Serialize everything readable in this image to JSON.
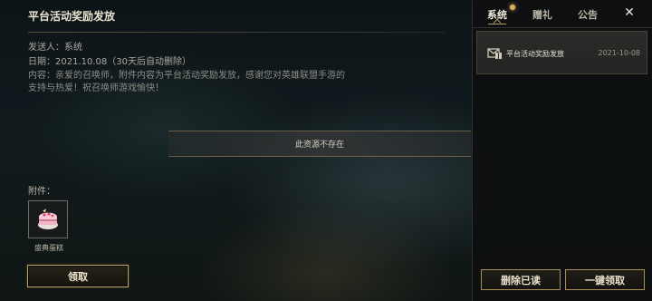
{
  "mail_detail": {
    "title": "平台活动奖励发放",
    "sender_label": "发送人：",
    "sender_value": "系统",
    "date_label": "日期：",
    "date_value": "2021.10.08（30天后自动删除）",
    "content_label": "内容：",
    "content_line1": "亲爱的召唤师，附件内容为平台活动奖励发放，感谢您对英雄联盟手游的",
    "content_line2": "支持与热爱！祝召唤师游戏愉快！",
    "attachments_label": "附件：",
    "attachments": [
      {
        "name": "盛典蛋糕",
        "icon": "cake-icon"
      }
    ],
    "claim_button": "领取"
  },
  "toast": {
    "message": "此资源不存在"
  },
  "panel": {
    "tabs": [
      {
        "label": "系统",
        "active": true,
        "has_notification": true
      },
      {
        "label": "赠礼",
        "active": false
      },
      {
        "label": "公告",
        "active": false
      }
    ],
    "close_icon": "close-icon",
    "mail_list": [
      {
        "title": "平台活动奖励发放",
        "date": "2021-10-08",
        "icon": "mail-gift-icon"
      }
    ],
    "delete_read_button": "删除已读",
    "claim_all_button": "一键领取"
  },
  "colors": {
    "accent_gold": "#c4a465",
    "notification_dot": "#d9b25a",
    "title_text": "#e9e4d2"
  }
}
